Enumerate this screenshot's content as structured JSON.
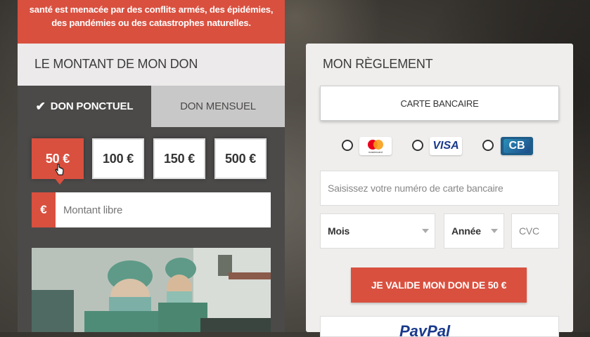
{
  "banner": {
    "line1": "santé est menacée par des conflits armés, des épidémies,",
    "line2": "des pandémies ou des catastrophes naturelles."
  },
  "amount_section": {
    "title": "LE MONTANT DE MON DON",
    "tabs": [
      {
        "label": "DON PONCTUEL",
        "selected": true
      },
      {
        "label": "DON MENSUEL",
        "selected": false
      }
    ],
    "amounts": [
      {
        "label": "50 €",
        "selected": true
      },
      {
        "label": "100 €",
        "selected": false
      },
      {
        "label": "150 €",
        "selected": false
      },
      {
        "label": "500 €",
        "selected": false
      }
    ],
    "free_amount": {
      "currency": "€",
      "placeholder": "Montant libre",
      "value": ""
    }
  },
  "payment": {
    "title": "MON RÈGLEMENT",
    "card_button": "CARTE BANCAIRE",
    "card_types": [
      {
        "name": "mastercard",
        "logo_text": "mastercard",
        "selected": false
      },
      {
        "name": "visa",
        "logo_text": "VISA",
        "selected": false
      },
      {
        "name": "cb",
        "logo_text": "CB",
        "selected": false
      }
    ],
    "card_number_placeholder": "Saisissez votre numéro de carte bancaire",
    "month_select": "Mois",
    "year_select": "Année",
    "cvc_placeholder": "CVC",
    "validate_button": "JE VALIDE MON DON DE  50 €",
    "paypal_label": "PayPal"
  },
  "colors": {
    "accent": "#d9503f",
    "dark_panel": "#4b4a49",
    "light_panel": "#efeeec"
  }
}
